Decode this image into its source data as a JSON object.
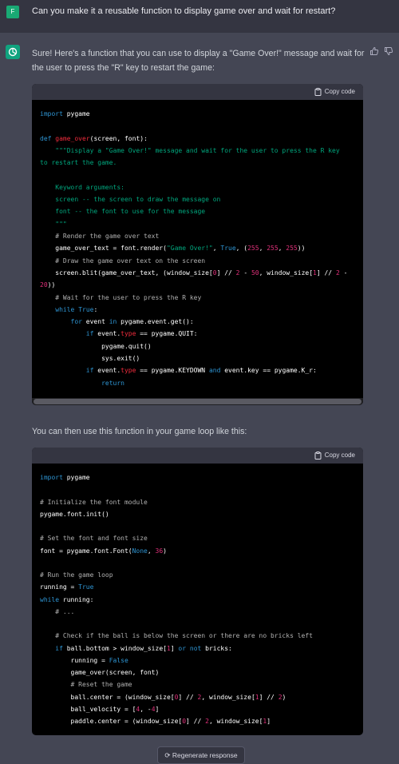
{
  "user_message": {
    "avatar_letter": "F",
    "text": "Can you make it a reusable function to display game over and wait for restart?"
  },
  "assistant": {
    "intro": "Sure! Here's a function that you can use to display a \"Game Over!\" message and wait for the user to press the \"R\" key to restart the game:",
    "between_text": "You can then use this function in your game loop like this:",
    "copy_label": "Copy code",
    "regenerate_label": "Regenerate response",
    "icons": [
      "thumbs-up-icon",
      "thumbs-down-icon",
      "clipboard-icon",
      "openai-logo-icon",
      "refresh-icon"
    ]
  },
  "code1_lines": [
    [
      [
        "import",
        "kw"
      ],
      [
        " pygame",
        ""
      ]
    ],
    [],
    [
      [
        "def",
        "kw"
      ],
      [
        " ",
        ""
      ],
      [
        "game_over",
        "fn"
      ],
      [
        "(screen, font):",
        ""
      ]
    ],
    [
      [
        "    \"\"\"Display a \"Game Over!\" message and wait for the user to press the R key",
        "st"
      ]
    ],
    [
      [
        "to restart the game.",
        "st"
      ]
    ],
    [],
    [
      [
        "    Keyword arguments:",
        "st"
      ]
    ],
    [
      [
        "    screen -- the screen to draw the message on",
        "st"
      ]
    ],
    [
      [
        "    font -- the font to use for the message",
        "st"
      ]
    ],
    [
      [
        "    \"\"\"",
        "st"
      ]
    ],
    [
      [
        "    # Render the game over text",
        "cm"
      ]
    ],
    [
      [
        "    game_over_text = font.render(",
        ""
      ],
      [
        "\"Game Over!\"",
        "st"
      ],
      [
        ", ",
        ""
      ],
      [
        "True",
        "kw"
      ],
      [
        ", (",
        ""
      ],
      [
        "255",
        "nm"
      ],
      [
        ", ",
        ""
      ],
      [
        "255",
        "nm"
      ],
      [
        ", ",
        ""
      ],
      [
        "255",
        "nm"
      ],
      [
        "))",
        ""
      ]
    ],
    [
      [
        "    # Draw the game over text on the screen",
        "cm"
      ]
    ],
    [
      [
        "    screen.blit(game_over_text, (window_size[",
        ""
      ],
      [
        "0",
        "nm"
      ],
      [
        "] // ",
        ""
      ],
      [
        "2",
        "nm"
      ],
      [
        " - ",
        ""
      ],
      [
        "50",
        "nm"
      ],
      [
        ", window_size[",
        ""
      ],
      [
        "1",
        "nm"
      ],
      [
        "] // ",
        ""
      ],
      [
        "2",
        "nm"
      ],
      [
        " -",
        ""
      ]
    ],
    [
      [
        "20",
        "nm"
      ],
      [
        "))",
        ""
      ]
    ],
    [
      [
        "    # Wait for the user to press the R key",
        "cm"
      ]
    ],
    [
      [
        "    ",
        ""
      ],
      [
        "while",
        "kw"
      ],
      [
        " ",
        ""
      ],
      [
        "True",
        "kw"
      ],
      [
        ":",
        ""
      ]
    ],
    [
      [
        "        ",
        ""
      ],
      [
        "for",
        "kw"
      ],
      [
        " event ",
        ""
      ],
      [
        "in",
        "kw"
      ],
      [
        " pygame.event.get():",
        ""
      ]
    ],
    [
      [
        "            ",
        ""
      ],
      [
        "if",
        "kw"
      ],
      [
        " event.",
        ""
      ],
      [
        "type",
        "fn"
      ],
      [
        " == pygame.QUIT:",
        ""
      ]
    ],
    [
      [
        "                pygame.quit()",
        ""
      ]
    ],
    [
      [
        "                sys.exit()",
        ""
      ]
    ],
    [
      [
        "            ",
        ""
      ],
      [
        "if",
        "kw"
      ],
      [
        " event.",
        ""
      ],
      [
        "type",
        "fn"
      ],
      [
        " == pygame.KEYDOWN ",
        ""
      ],
      [
        "and",
        "kw"
      ],
      [
        " event.key == pygame.K_r:",
        ""
      ]
    ],
    [
      [
        "                ",
        ""
      ],
      [
        "return",
        "kw"
      ]
    ]
  ],
  "code2_lines": [
    [
      [
        "import",
        "kw"
      ],
      [
        " pygame",
        ""
      ]
    ],
    [],
    [
      [
        "# Initialize the font module",
        "cm"
      ]
    ],
    [
      [
        "pygame.font.init()",
        ""
      ]
    ],
    [],
    [
      [
        "# Set the font and font size",
        "cm"
      ]
    ],
    [
      [
        "font = pygame.font.Font(",
        ""
      ],
      [
        "None",
        "kw"
      ],
      [
        ", ",
        ""
      ],
      [
        "36",
        "nm"
      ],
      [
        ")",
        ""
      ]
    ],
    [],
    [
      [
        "# Run the game loop",
        "cm"
      ]
    ],
    [
      [
        "running = ",
        ""
      ],
      [
        "True",
        "kw"
      ]
    ],
    [
      [
        "while",
        "kw"
      ],
      [
        " running:",
        ""
      ]
    ],
    [
      [
        "    # ...",
        "cm"
      ]
    ],
    [],
    [
      [
        "    # Check if the ball is below the screen or there are no bricks left",
        "cm"
      ]
    ],
    [
      [
        "    ",
        ""
      ],
      [
        "if",
        "kw"
      ],
      [
        " ball.bottom > window_size[",
        ""
      ],
      [
        "1",
        "nm"
      ],
      [
        "] ",
        ""
      ],
      [
        "or",
        "kw"
      ],
      [
        " ",
        ""
      ],
      [
        "not",
        "kw"
      ],
      [
        " bricks:",
        ""
      ]
    ],
    [
      [
        "        running = ",
        ""
      ],
      [
        "False",
        "kw"
      ]
    ],
    [
      [
        "        game_over(screen, font)",
        ""
      ]
    ],
    [
      [
        "        # Reset the game",
        "cm"
      ]
    ],
    [
      [
        "        ball.center = (window_size[",
        ""
      ],
      [
        "0",
        "nm"
      ],
      [
        "] // ",
        ""
      ],
      [
        "2",
        "nm"
      ],
      [
        ", window_size[",
        ""
      ],
      [
        "1",
        "nm"
      ],
      [
        "] // ",
        ""
      ],
      [
        "2",
        "nm"
      ],
      [
        ")",
        ""
      ]
    ],
    [
      [
        "        ball_velocity = [",
        ""
      ],
      [
        "4",
        "nm"
      ],
      [
        ", -",
        ""
      ],
      [
        "4",
        "nm"
      ],
      [
        "]",
        ""
      ]
    ],
    [
      [
        "        paddle.center = (window_size[",
        ""
      ],
      [
        "0",
        "nm"
      ],
      [
        "] // ",
        ""
      ],
      [
        "2",
        "nm"
      ],
      [
        ", window_size[",
        ""
      ],
      [
        "1",
        "nm"
      ],
      [
        "]",
        ""
      ]
    ]
  ]
}
